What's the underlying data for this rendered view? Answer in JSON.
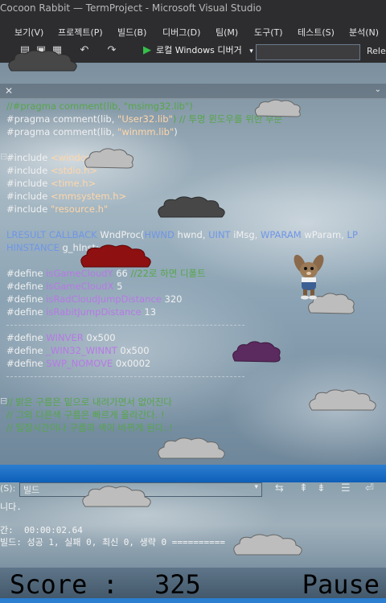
{
  "window": {
    "title": "Cocoon Rabbit — TermProject - Microsoft Visual Studio"
  },
  "menu": [
    "보기(V)",
    "프로젝트(P)",
    "빌드(B)",
    "디버그(D)",
    "팀(M)",
    "도구(T)",
    "테스트(S)",
    "분석(N)"
  ],
  "toolbar": {
    "run_label": "로컬 Windows 디버거",
    "config_label": "Rele"
  },
  "code": {
    "l1": "//#pragma comment(lib, \"msimg32.lib\")",
    "l2a": "#pragma comment(lib, ",
    "l2b": "\"User32.lib\"",
    "l2c": ") // 투명 윈도우를 위한 부분",
    "l3a": "#pragma comment(lib, ",
    "l3b": "\"winmm.lib\"",
    "l3c": ")",
    "l5a": "#include ",
    "l5b": "<windows.h>",
    "l6b": "<stdio.h>",
    "l7b": "<time.h>",
    "l8b": "<mmsystem.h>",
    "l9b": "\"resource.h\"",
    "l11a": "LRESULT CALLBACK ",
    "l11b": "WndProc(",
    "l11c": "HWND",
    "l11d": " hwnd, ",
    "l11e": "UINT",
    "l11f": " iMsg, ",
    "l11g": "WPARAM",
    "l11h": " wParam, ",
    "l11i": "LP",
    "l12a": "HINSTANCE",
    "l12b": " g_hInst;",
    "l14a": "#define ",
    "l14b": "isGameCloudY",
    "l14c": " 66 ",
    "l14d": "//22로 하면 디폴트",
    "l15b": "isGameCloudX",
    "l15c": " 5",
    "l16b": "isRadCloudJumpDistance",
    "l16c": " 320",
    "l17b": "isRabitJumpDistance",
    "l17c": " 13",
    "l19b": "WINVER",
    "l19c": " 0x500",
    "l20b": "_WIN32_WINNT",
    "l20c": " 0x500",
    "l21b": "SWP_NOMOVE",
    "l21c": " 0x0002",
    "l23": "// 밝은 구름은 밑으로 내려가면서 없어진다",
    "l24": "// 그외 다른색 구름은 빠르게 올라간다. !",
    "l25": "// 일정시간이나 구름의 색이 바뀌게 된다..!"
  },
  "output": {
    "source_label": "(S):",
    "source_value": "빌드",
    "line1": "니다.",
    "line2": "간:  00:00:02.64",
    "line3": "빌드: 성공 1, 실패 0, 최신 0, 생략 0 =========="
  },
  "hud": {
    "score_label": "Score :",
    "score_value": "325",
    "pause_label": "Pause"
  },
  "colors": {
    "cloud_gray": "#474747",
    "cloud_light": "#bdbdbd",
    "cloud_red": "#8e1010",
    "cloud_purple": "#5b2a5e",
    "accent_blue": "#2b7ed0"
  }
}
